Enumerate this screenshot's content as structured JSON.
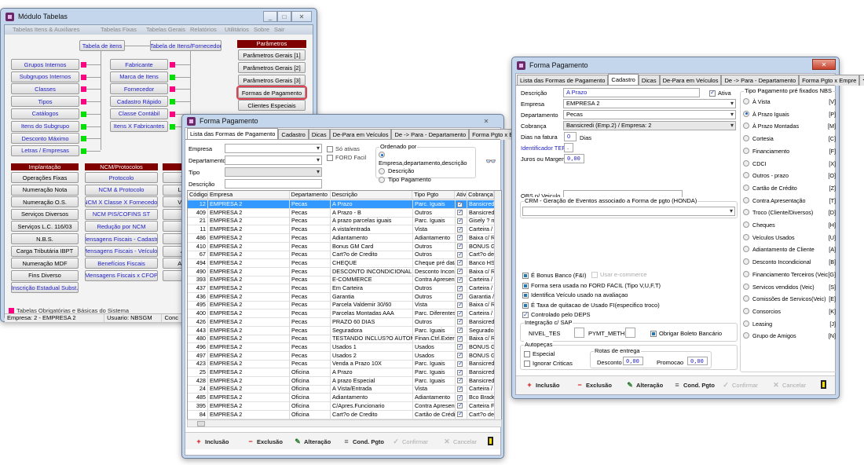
{
  "win1": {
    "title": "Módulo Tabelas",
    "menu": [
      "Tabelas Itens & Auxiliares",
      "Tabelas Fixas",
      "Tabelas Gerais",
      "Relatórios",
      "Utilitários",
      "Sobre",
      "Sair"
    ],
    "top_buttons": [
      "Tabela de itens",
      "Tabela de Itens/Fornecedor"
    ],
    "left_buttons": [
      {
        "label": "Grupos Internos",
        "flag": "#ff0080"
      },
      {
        "label": "Subgrupos Internos",
        "flag": "#ff0080"
      },
      {
        "label": "Classes",
        "flag": "#ff0080"
      },
      {
        "label": "Tipos",
        "flag": "#ff0080"
      },
      {
        "label": "Catálogos",
        "flag": "#00e000"
      },
      {
        "label": "Itens do Subgrupo",
        "flag": "#00e000"
      },
      {
        "label": "Desconto Máximo",
        "flag": "#00e000"
      },
      {
        "label": "Letras / Empresas",
        "flag": "#00e000"
      }
    ],
    "mid_buttons": [
      {
        "label": "Fabricante",
        "flag": "#ff0080"
      },
      {
        "label": "Marca de Itens",
        "flag": "#00e000"
      },
      {
        "label": "Fornecedor",
        "flag": "#ff0080"
      },
      {
        "label": "Cadastro Rápido",
        "flag": "#00e000"
      },
      {
        "label": "Classe Contábil",
        "flag": "#ff0080"
      },
      {
        "label": "Itens X Fabricantes",
        "flag": "#00e000"
      }
    ],
    "params_header": "Parâmetros",
    "params_buttons": [
      "Parâmetros Gerais [1]",
      "Parâmetros Gerais [2]",
      "Parâmetros Gerais [3]",
      "Formas de Pagamento",
      "Clientes Especiais"
    ],
    "implantacao_header": "Implantação",
    "implantacao": [
      "Operações Fixas",
      "Numeração Nota",
      "Numeração O.S.",
      "Serviços Diversos",
      "Serviços L.C. 116/03",
      "N.B.S.",
      "Carga Tributária IBPT",
      "Numeração MDF",
      "Fins Diverso",
      "Inscrição Estadual Subst."
    ],
    "ncm_header": "NCM/Protocolos",
    "ncm": [
      "Protocolo",
      "NCM & Protocolo",
      "NCM X Classe X Fornecedor",
      "NCM PIS/COFINS ST",
      "Redução por NCM",
      "Mensagens Fiscais - Cadastro",
      "Mensagens Fiscais - Veículos",
      "Benefícios Fiscais",
      "Mensagens Fiscais x CFOP"
    ],
    "third_col": [
      "T",
      "Lo",
      "Ve",
      "",
      "",
      "",
      "A",
      "Alí",
      ""
    ],
    "legend": "Tabelas Obrigatórias e Básicas do Sistema",
    "status": [
      "Empresa: 2 - EMPRESA 2",
      "Usuario: NBSGM",
      "Conc"
    ]
  },
  "win2": {
    "title": "Forma Pagamento",
    "tabs": [
      "Lista das Formas de Pagamento",
      "Cadastro",
      "Dicas",
      "De-Para em Veículos",
      "De -> Para - Departamento",
      "Forma Pgto x Empre"
    ],
    "filters": {
      "empresa": "Empresa",
      "departamento": "Departamento",
      "tipo": "Tipo",
      "descricao": "Descrição",
      "so_ativas": "Só ativas",
      "ford_facil": "FORD Facil"
    },
    "ordenado": {
      "title": "Ordenado por",
      "options": [
        "Empresa,departamento,descrição",
        "Descrição",
        "Tipo Pagamento"
      ],
      "selected": 0
    },
    "columns": [
      "Código",
      "Empresa",
      "Departamento",
      "Descrição",
      "Tipo Pgto",
      "Ativa",
      "Cobrança"
    ],
    "rows": [
      [
        "12",
        "EMPRESA 2",
        "Pecas",
        "A Prazo",
        "Parc. Iguais",
        true,
        "Bansicredi"
      ],
      [
        "409",
        "EMPRESA 2",
        "Pecas",
        "A Prazo - B",
        "Outros",
        true,
        "Bansicredi"
      ],
      [
        "21",
        "EMPRESA 2",
        "Pecas",
        "A prazo parcelas iguais",
        "Parc. Iguais",
        true,
        "Gisely ? m"
      ],
      [
        "11",
        "EMPRESA 2",
        "Pecas",
        "A vista/entrada",
        "Vista",
        true,
        "Carteira / E"
      ],
      [
        "486",
        "EMPRESA 2",
        "Pecas",
        "Adiantamento",
        "Adiantamento",
        true,
        "Baixa c/ R"
      ],
      [
        "410",
        "EMPRESA 2",
        "Pecas",
        "Bonus GM Card",
        "Outros",
        true,
        "BONUS G"
      ],
      [
        "67",
        "EMPRESA 2",
        "Pecas",
        "Cart?o de Credito",
        "Outros",
        true,
        "Cart?o de"
      ],
      [
        "494",
        "EMPRESA 2",
        "Pecas",
        "CHEQUE",
        "Cheque pré data",
        true,
        "Banco HS"
      ],
      [
        "490",
        "EMPRESA 2",
        "Pecas",
        "DESCONTO INCONDICIONAL",
        "Desconto Incond",
        true,
        "Baixa c/ R"
      ],
      [
        "393",
        "EMPRESA 2",
        "Pecas",
        "E-COMMERCE",
        "Contra Apresenta",
        true,
        "Carteira / E"
      ],
      [
        "437",
        "EMPRESA 2",
        "Pecas",
        "Em Carteira",
        "Outros",
        true,
        "Carteira / E"
      ],
      [
        "436",
        "EMPRESA 2",
        "Pecas",
        "Garantia",
        "Outros",
        true,
        "Garantia /"
      ],
      [
        "495",
        "EMPRESA 2",
        "Pecas",
        "Parcela Valdemir 30/60",
        "Vista",
        true,
        "Baixa c/ R"
      ],
      [
        "400",
        "EMPRESA 2",
        "Pecas",
        "Parcelas Montadas AAA",
        "Parc. Diferentes",
        true,
        "Carteira / E"
      ],
      [
        "426",
        "EMPRESA 2",
        "Pecas",
        "PRAZO 60 DIAS",
        "Outros",
        true,
        "Bansicredi"
      ],
      [
        "443",
        "EMPRESA 2",
        "Pecas",
        "Seguradora",
        "Parc. Iguais",
        true,
        "Segurador"
      ],
      [
        "480",
        "EMPRESA 2",
        "Pecas",
        "TESTANDO INCLUS?O AUTOMA",
        "Finan.Ctrl.Externo",
        true,
        "Baixa c/ R"
      ],
      [
        "496",
        "EMPRESA 2",
        "Pecas",
        "Usados 1",
        "Usados",
        true,
        "BONUS G"
      ],
      [
        "497",
        "EMPRESA 2",
        "Pecas",
        "Usados 2",
        "Usados",
        true,
        "BONUS G"
      ],
      [
        "423",
        "EMPRESA 2",
        "Pecas",
        "Venda a Prazo 10X",
        "Parc. Iguais",
        true,
        "Bansicredi"
      ],
      [
        "25",
        "EMPRESA 2",
        "Oficina",
        "A Prazo",
        "Parc. Iguais",
        true,
        "Bansicredi"
      ],
      [
        "428",
        "EMPRESA 2",
        "Oficina",
        "A prazo Especial",
        "Parc. Iguais",
        true,
        "Bansicredi"
      ],
      [
        "24",
        "EMPRESA 2",
        "Oficina",
        "A Vista/Entrada",
        "Vista",
        true,
        "Carteira / E"
      ],
      [
        "485",
        "EMPRESA 2",
        "Oficina",
        "Adiantamento",
        "Adiantamento",
        true,
        "Bco Brade"
      ],
      [
        "395",
        "EMPRESA 2",
        "Oficina",
        "C/Apres.Funcionario",
        "Contra Apresenta",
        true,
        "Carteira Fu"
      ],
      [
        "84",
        "EMPRESA 2",
        "Oficina",
        "Cart?o de Credito",
        "Cartão de Crédito",
        true,
        "Cart?o de"
      ]
    ],
    "toolbar": [
      {
        "label": "Inclusão",
        "icon": "+",
        "color": "#d00000",
        "enabled": true
      },
      {
        "label": "Exclusão",
        "icon": "−",
        "color": "#d00000",
        "enabled": true
      },
      {
        "label": "Alteração",
        "icon": "✎",
        "color": "#2a7a2a",
        "enabled": true
      },
      {
        "label": "Cond. Pgto",
        "icon": "≡",
        "color": "#555",
        "enabled": true
      },
      {
        "label": "Confirmar",
        "icon": "✓",
        "color": "#bbb",
        "enabled": false
      },
      {
        "label": "Cancelar",
        "icon": "✕",
        "color": "#bbb",
        "enabled": false
      }
    ]
  },
  "win3": {
    "title": "Forma Pagamento",
    "tabs": [
      "Lista das Formas de Pagamento",
      "Cadastro",
      "Dicas",
      "De-Para em Veículos",
      "De -> Para - Departamento",
      "Forma Pgto x Empre"
    ],
    "descricao_label": "Descrição",
    "descricao": "A Prazo",
    "ativa_label": "Ativa",
    "empresa_label": "Empresa",
    "empresa": "EMPRESA 2",
    "departamento_label": "Departamento",
    "departamento": "Pecas",
    "cobranca_label": "Cobrança",
    "cobranca": "Bansicredi (Emp.2) / Empresa: 2",
    "dias_label": "Dias na fatura",
    "dias": "0",
    "dias_unit": "Dias",
    "tef_label": "Identificador TEF",
    "tef": ".",
    "juros_label": "Juros ou Margem",
    "juros": "0,00",
    "obs_label": "OBS p/ Veiculo",
    "crm_title": "CRM - Geração de Eventos associado  a Forma de pgto (HONDA)",
    "checks": [
      {
        "label": "É Bonus Banco (F&I)",
        "state": "indeterminate"
      },
      {
        "label": "Forma sera usada no FORD FACIL (Tipo V,U,F,T)",
        "state": "indeterminate"
      },
      {
        "label": "Identifica Veículo usado na avaliaçao",
        "state": "indeterminate"
      },
      {
        "label": "É Taxa de quitacao de Usado FI(especifico troco)",
        "state": "indeterminate"
      },
      {
        "label": "Controlado pelo DEPS",
        "state": "checked"
      }
    ],
    "ecommerce_label": "Usar e-commerce",
    "sap": {
      "title": "Integração c/ SAP",
      "nivel": "NIVEL_TES",
      "pymt": "PYMT_METH",
      "boleto": "Obrigar Boleto Bancário"
    },
    "autopecas": {
      "title": "Autopeças",
      "especial": "Especial",
      "ignorar": "Ignorar Criticas",
      "rotas_title": "Rotas de entrega",
      "desconto_label": "Desconto",
      "desconto": "0,00",
      "promocao_label": "Promocao",
      "promocao": "0,00"
    },
    "tipo_title": "Tipo Pagamento pré fixados  NBS",
    "tipos": [
      [
        "À Vista",
        "[V]"
      ],
      [
        "À Prazo Iguais",
        "[P]"
      ],
      [
        "À Prazo Montadas",
        "[M]"
      ],
      [
        "Cortesia",
        "[C]"
      ],
      [
        "Financiamento",
        "[F]"
      ],
      [
        "CDCI",
        "[X]"
      ],
      [
        "Outros - prazo",
        "[O]"
      ],
      [
        "Cartão de Crédito",
        "[Z]"
      ],
      [
        "Contra Apresentação",
        "[T]"
      ],
      [
        "Troco  (Cliente/Diversos)",
        "[D]"
      ],
      [
        "Cheques",
        "[H]"
      ],
      [
        "Veículos Usados",
        "[U]"
      ],
      [
        "Adiantamento de Cliente",
        "[A]"
      ],
      [
        "Desconto Incondicional",
        "[B]"
      ],
      [
        "Financiamento Terceiros (Veic)",
        "[G]"
      ],
      [
        "Servicos vendidos (Veic)",
        "[S]"
      ],
      [
        "Comissões de Servicos(Veic)",
        "[E]"
      ],
      [
        "Consorcios",
        "[K]"
      ],
      [
        "Leasing",
        "[J]"
      ],
      [
        "Grupo de Amigos",
        "[N]"
      ]
    ],
    "tipo_selected": 1
  }
}
